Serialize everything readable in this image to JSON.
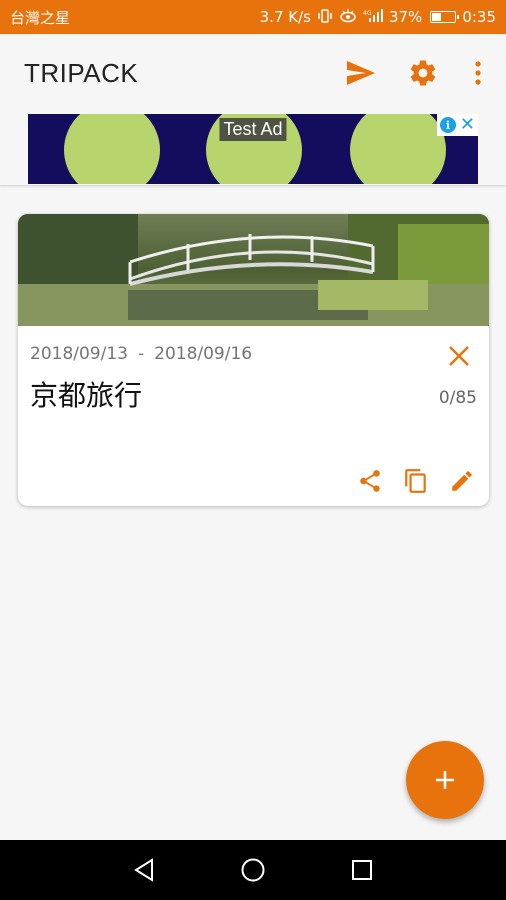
{
  "status_bar": {
    "carrier": "台灣之星",
    "network_speed": "3.7 K/s",
    "battery_percent": "37%",
    "battery_level": 0.37,
    "time": "0:35",
    "icons": [
      "vibrate-icon",
      "eye-icon",
      "signal-icon",
      "battery-icon"
    ]
  },
  "app_bar": {
    "title": "TRIPACK",
    "actions": [
      "send-icon",
      "settings-icon",
      "more-vert-icon"
    ]
  },
  "ad": {
    "label": "Test Ad",
    "colors": {
      "background": "#140c5c",
      "circles": "#b8d46c",
      "badge": "#1aa1e8"
    }
  },
  "trips": [
    {
      "start_date": "2018/09/13",
      "separator": "-",
      "end_date": "2018/09/16",
      "title": "京都旅行",
      "count": "0/85",
      "actions": [
        "share-icon",
        "copy-icon",
        "edit-icon"
      ]
    }
  ],
  "fab": {
    "icon": "add-icon"
  },
  "colors": {
    "accent": "#e8720c"
  },
  "nav": [
    "back-icon",
    "home-icon",
    "recents-icon"
  ]
}
